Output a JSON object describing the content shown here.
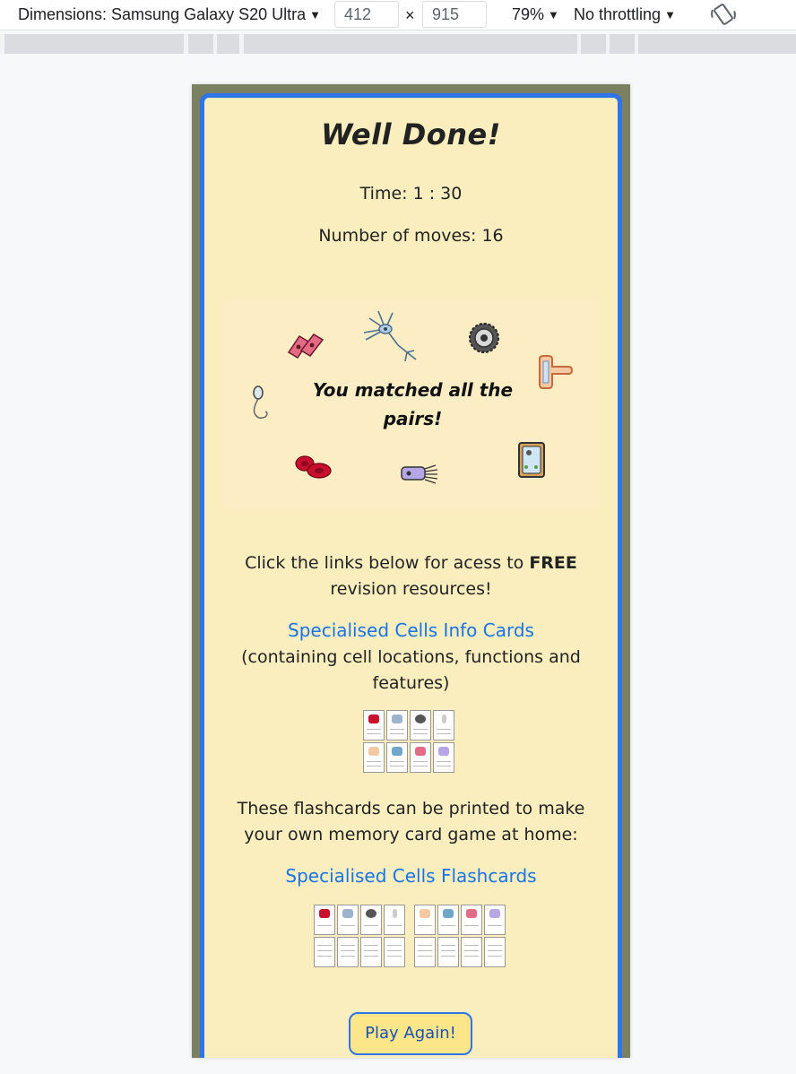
{
  "devtools": {
    "dimensions_label": "Dimensions: Samsung Galaxy S20 Ultra",
    "width": "412",
    "height": "915",
    "times": "×",
    "zoom": "79%",
    "throttling": "No throttling",
    "caret": "▼"
  },
  "modal": {
    "title": "Well Done!",
    "time_text": "Time: 1 : 30",
    "moves_text": "Number of moves: 16",
    "matched_text": "You matched all the pairs!",
    "resources_text_1": "Click the links below for acess to ",
    "resources_bold": "FREE",
    "resources_text_2": " revision resources!",
    "info_cards_link": "Specialised Cells Info Cards",
    "info_cards_desc": "(containing cell locations, functions and features)",
    "flashcards_text": "These flashcards can be printed to make your own memory card game at home:",
    "flashcards_link": "Specialised Cells Flashcards",
    "play_again": "Play Again!"
  },
  "colors": {
    "modal_bg": "#fbeebe",
    "border": "#2f74ea",
    "link": "#1a73e8",
    "button_bg": "#fde68a",
    "page_bg": "#7a8060"
  },
  "icons": [
    "muscle-cell-icon",
    "neuron-icon",
    "egg-cell-icon",
    "root-hair-cell-icon",
    "sperm-cell-icon",
    "red-blood-cell-icon",
    "ciliated-cell-icon",
    "plant-cell-icon",
    "rotate-icon"
  ]
}
